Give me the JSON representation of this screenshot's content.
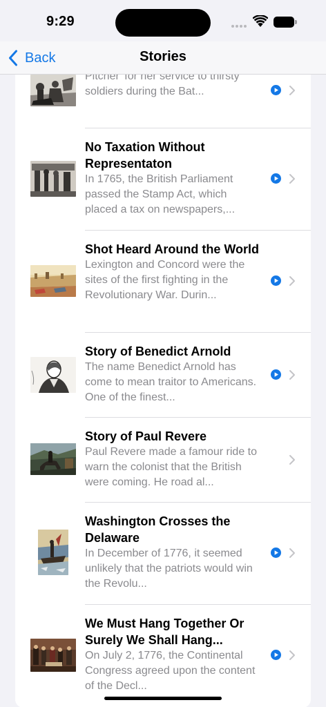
{
  "status_bar": {
    "time": "9:29"
  },
  "nav": {
    "back_label": "Back",
    "title": "Stories"
  },
  "colors": {
    "accent": "#1478e6",
    "secondary_text": "#8a8a8e",
    "background": "#f2f2f7"
  },
  "stories": [
    {
      "title": "",
      "description": "Mary Hays, nicknamed 'Molly Pitcher' for her service to thirsty soldiers during the Bat...",
      "has_audio": true
    },
    {
      "title": "No Taxation Without Representaton",
      "description": "In 1765, the British Parliament passed the Stamp Act, which placed a tax on newspapers,...",
      "has_audio": true
    },
    {
      "title": "Shot Heard Around the World",
      "description": "Lexington and Concord were the sites of the first fighting in the Revolutionary War. Durin...",
      "has_audio": true
    },
    {
      "title": "Story of Benedict Arnold",
      "description": "The name Benedict Arnold has come to mean traitor to Americans. One of the finest...",
      "has_audio": true
    },
    {
      "title": "Story of Paul Revere",
      "description": "Paul Revere made a famour ride to warn the colonist that the British were coming. He road al...",
      "has_audio": false
    },
    {
      "title": "Washington Crosses the Delaware",
      "description": "In December of 1776, it seemed unlikely that the patriots would win the Revolu...",
      "has_audio": true
    },
    {
      "title": "We Must Hang Together Or Surely We Shall Hang...",
      "description": "On July 2, 1776, the Continental Congress agreed upon the content of the Decl...",
      "has_audio": true
    }
  ]
}
